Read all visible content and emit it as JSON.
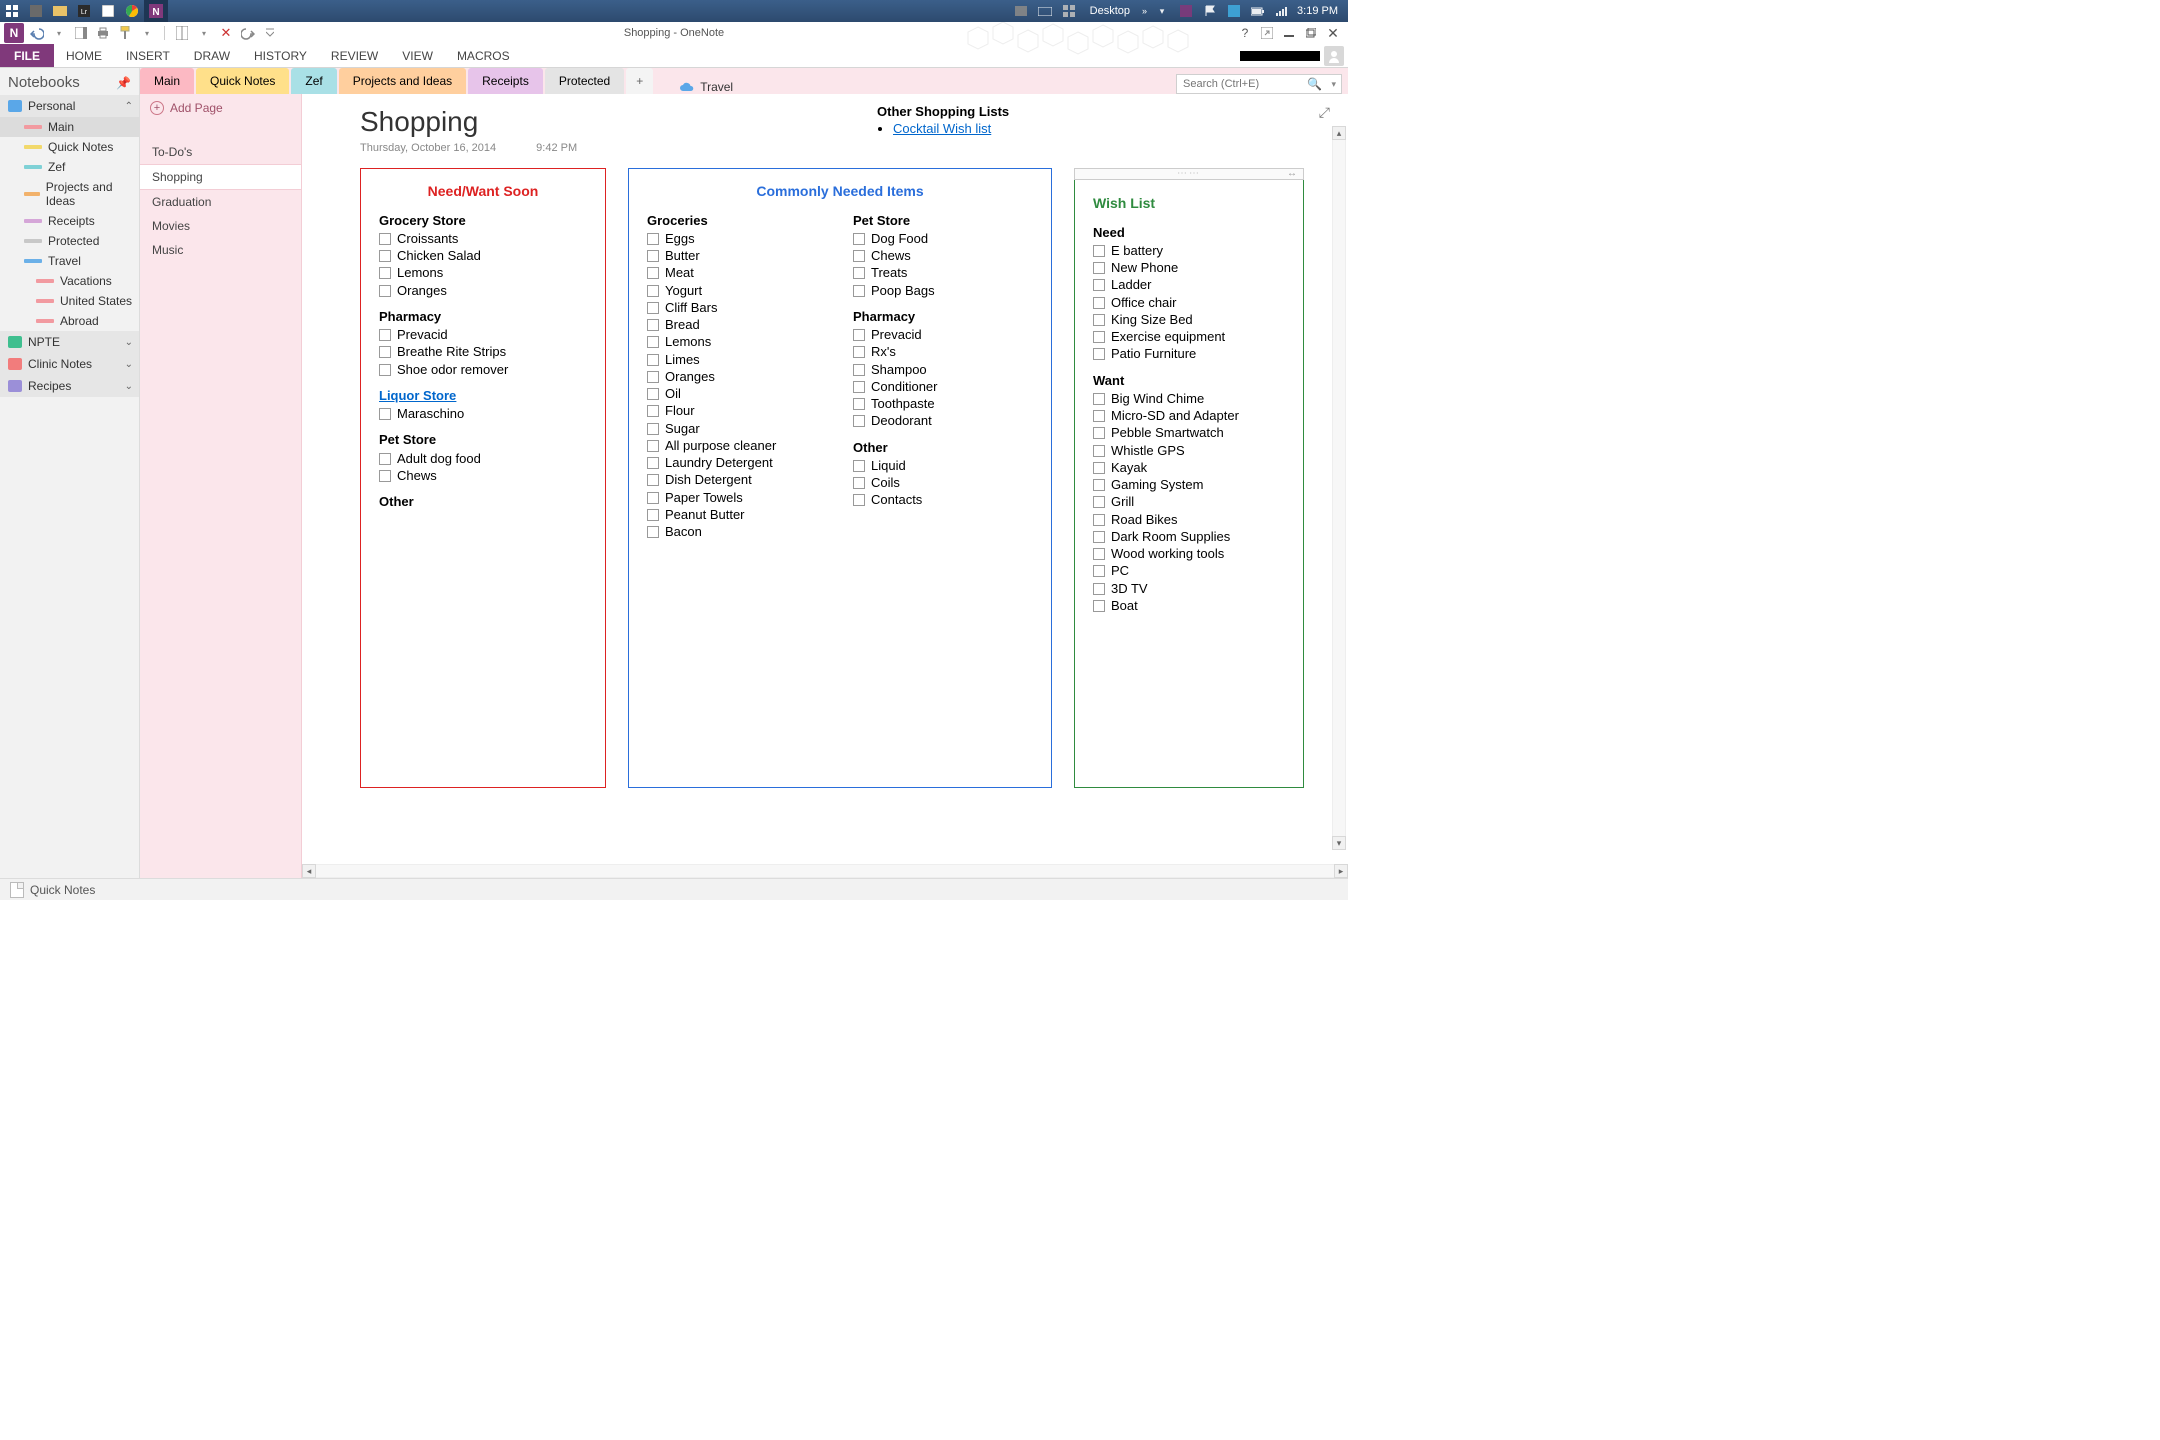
{
  "taskbar": {
    "desktop_label": "Desktop",
    "clock": "3:19 PM"
  },
  "titlebar": {
    "title": "Shopping - OneNote"
  },
  "ribbon": {
    "file": "FILE",
    "tabs": [
      "HOME",
      "INSERT",
      "DRAW",
      "HISTORY",
      "REVIEW",
      "VIEW",
      "MACROS"
    ]
  },
  "notebooks": {
    "heading": "Notebooks",
    "groups": [
      {
        "name": "Personal",
        "color": "#5aa7e8",
        "items": [
          {
            "label": "Main",
            "color": "#f29aa0",
            "selected": true
          },
          {
            "label": "Quick Notes",
            "color": "#f2d96b"
          },
          {
            "label": "Zef",
            "color": "#7fd1d6"
          },
          {
            "label": "Projects and Ideas",
            "color": "#f2b26b"
          },
          {
            "label": "Receipts",
            "color": "#d5a6d8"
          },
          {
            "label": "Protected",
            "color": "#c8c8c8"
          },
          {
            "label": "Travel",
            "color": "#6bb0e8",
            "children": [
              {
                "label": "Vacations",
                "color": "#f29aa0"
              },
              {
                "label": "United States",
                "color": "#f29aa0"
              },
              {
                "label": "Abroad",
                "color": "#f29aa0"
              }
            ]
          }
        ]
      },
      {
        "name": "NPTE",
        "color": "#3fbf8f"
      },
      {
        "name": "Clinic Notes",
        "color": "#f27c7c"
      },
      {
        "name": "Recipes",
        "color": "#9b8fd8"
      }
    ]
  },
  "sections": {
    "tabs": [
      {
        "label": "Main",
        "bg": "#fcb9c3",
        "active": true
      },
      {
        "label": "Quick Notes",
        "bg": "#ffe08a"
      },
      {
        "label": "Zef",
        "bg": "#a9e0e6"
      },
      {
        "label": "Projects and Ideas",
        "bg": "#ffcf9e"
      },
      {
        "label": "Receipts",
        "bg": "#e7c4ea"
      },
      {
        "label": "Protected",
        "bg": "#e4e4e4"
      }
    ],
    "favorite": "Travel",
    "search_placeholder": "Search (Ctrl+E)"
  },
  "pages": {
    "add": "Add Page",
    "items": [
      {
        "label": "To-Do's"
      },
      {
        "label": "Shopping",
        "selected": true
      },
      {
        "label": "Graduation"
      },
      {
        "label": "Movies"
      },
      {
        "label": "Music"
      }
    ]
  },
  "note": {
    "title": "Shopping",
    "date": "Thursday, October 16, 2014",
    "time": "9:42 PM",
    "other_heading": "Other Shopping Lists",
    "other_link": "Cocktail Wish list",
    "box1": {
      "heading": "Need/Want Soon",
      "groups": [
        {
          "h": "Grocery Store",
          "items": [
            "Croissants",
            "Chicken Salad",
            "Lemons",
            "Oranges"
          ]
        },
        {
          "h": "Pharmacy",
          "items": [
            "Prevacid",
            "Breathe Rite Strips",
            "Shoe odor remover"
          ]
        },
        {
          "h": "Liquor Store",
          "link": true,
          "items": [
            "Maraschino"
          ]
        },
        {
          "h": "Pet Store",
          "items": [
            "Adult dog food",
            "Chews"
          ]
        },
        {
          "h": "Other",
          "items": []
        }
      ]
    },
    "box2": {
      "heading": "Commonly Needed Items",
      "colA": [
        {
          "h": "Groceries",
          "items": [
            "Eggs",
            "Butter",
            "Meat",
            "Yogurt",
            "Cliff Bars",
            "Bread",
            "Lemons",
            "Limes",
            "Oranges",
            "Oil",
            "Flour",
            "Sugar",
            "All purpose cleaner",
            "Laundry Detergent",
            "Dish Detergent",
            "Paper Towels",
            "Peanut Butter",
            "Bacon"
          ]
        }
      ],
      "colB": [
        {
          "h": "Pet Store",
          "items": [
            "Dog Food",
            "Chews",
            "Treats",
            "Poop Bags"
          ]
        },
        {
          "h": "Pharmacy",
          "items": [
            "Prevacid",
            "Rx's",
            "Shampoo",
            "Conditioner",
            "Toothpaste",
            "Deodorant"
          ]
        },
        {
          "h": "Other",
          "items": [
            "Liquid",
            "Coils",
            "Contacts"
          ]
        }
      ]
    },
    "box3": {
      "heading": "Wish List",
      "groups": [
        {
          "h": "Need",
          "items": [
            "E battery",
            "New Phone",
            "Ladder",
            "Office chair",
            "King Size Bed",
            "Exercise equipment",
            "Patio Furniture"
          ]
        },
        {
          "h": "Want",
          "items": [
            "Big Wind Chime",
            "Micro-SD and Adapter",
            "Pebble Smartwatch",
            "Whistle GPS",
            "Kayak",
            "Gaming System",
            "Grill",
            "Road Bikes",
            "Dark Room Supplies",
            "Wood working tools",
            "PC",
            "3D TV",
            "Boat"
          ]
        }
      ]
    }
  },
  "statusbar": {
    "quick_notes": "Quick Notes"
  }
}
